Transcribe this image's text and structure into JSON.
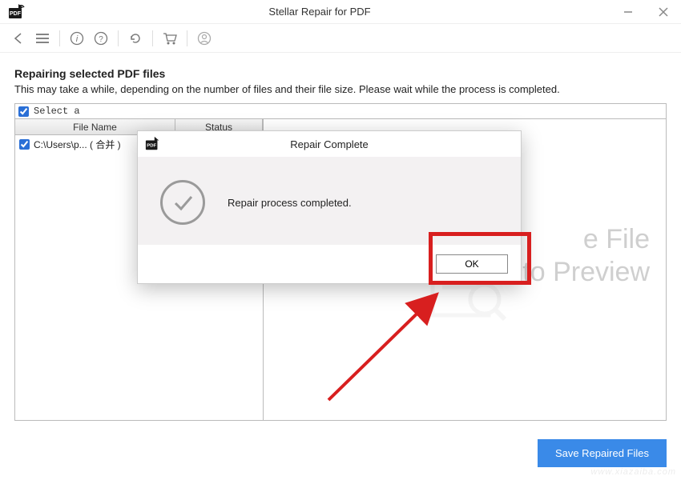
{
  "window": {
    "title": "Stellar Repair for PDF"
  },
  "toolbar": {
    "back": "back",
    "menu": "menu",
    "info": "info",
    "help": "help",
    "refresh": "refresh",
    "cart": "cart",
    "user": "user"
  },
  "main": {
    "heading": "Repairing selected PDF files",
    "subheading": "This may take a while, depending on the number of files and their file size. Please wait while the process is completed.",
    "select_all_label": "Select a",
    "select_all_checked": true,
    "columns": {
      "file_name": "File Name",
      "status": "Status"
    },
    "rows": [
      {
        "checked": true,
        "file_name": "C:\\Users\\p... ( 合并 )",
        "status": ""
      }
    ],
    "preview_placeholder_line1": "e File",
    "preview_placeholder_line2": "to Preview"
  },
  "dialog": {
    "title": "Repair Complete",
    "message": "Repair process completed.",
    "ok_label": "OK"
  },
  "footer": {
    "save_label": "Save Repaired Files"
  },
  "watermark": "www.xiazaiba.com",
  "colors": {
    "accent": "#3a8ae8",
    "highlight": "#d81f1f"
  }
}
